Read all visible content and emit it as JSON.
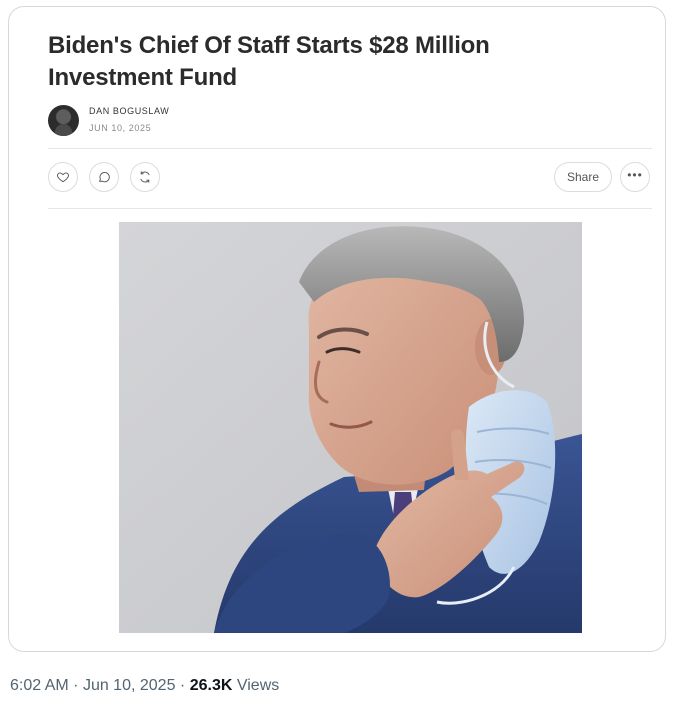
{
  "article": {
    "title": "Biden's Chief Of Staff Starts $28 Million Investment Fund",
    "author": "DAN BOGUSLAW",
    "date": "JUN 10, 2025",
    "share_label": "Share",
    "more_label": "•••",
    "icons": {
      "like": "heart-icon",
      "comment": "comment-icon",
      "restack": "refresh-icon",
      "more": "more-dots-icon"
    },
    "image": {
      "description_icon": "photo",
      "colors": {
        "background": "#cccdd0",
        "suit": "#2f4a86",
        "mask": "#bcd3ec"
      }
    }
  },
  "tweet_meta": {
    "time": "6:02 AM",
    "separator": "·",
    "date": "Jun 10, 2025",
    "views_count": "26.3K",
    "views_label": "Views"
  }
}
